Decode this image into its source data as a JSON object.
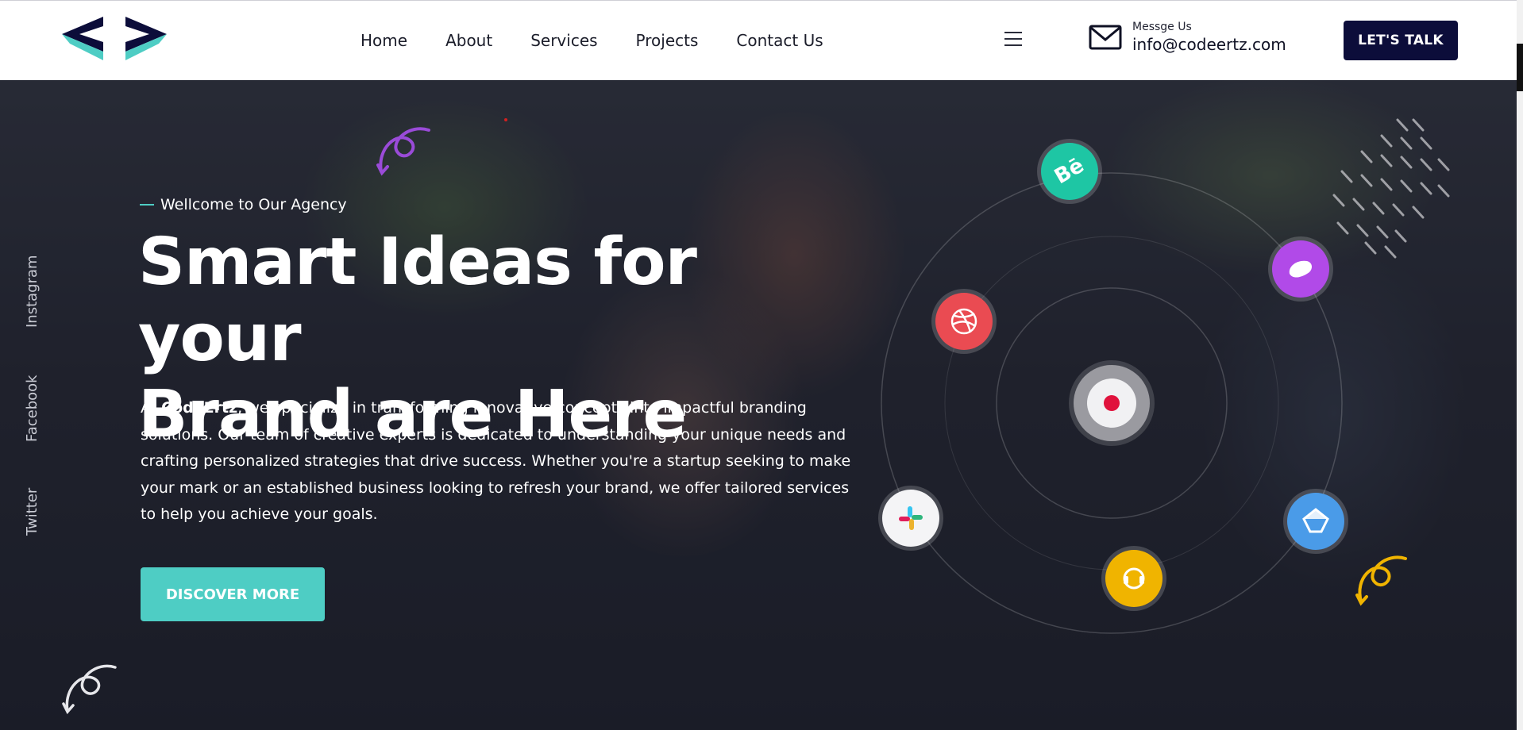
{
  "header": {
    "nav": [
      "Home",
      "About",
      "Services",
      "Projects",
      "Contact Us"
    ],
    "contact_label": "Messge Us",
    "contact_email": "info@codeertz.com",
    "cta_label": "LET'S TALK"
  },
  "social": [
    "Instagram",
    "Facebook",
    "Twitter"
  ],
  "hero": {
    "eyebrow": "Wellcome to Our Agency",
    "title_line1": "Smart Ideas for your",
    "title_line2": "Brand are Here",
    "description_prefix": "At ",
    "description_brand": "CodeErtz",
    "description_rest": ", we specialize in transforming innovative concepts into impactful branding solutions. Our team of creative experts is dedicated to understanding your unique needs and crafting personalized strategies that drive success. Whether you're a startup seeking to make your mark or an established business looking to refresh your brand, we offer tailored services to help you achieve your goals.",
    "button_label": "DISCOVER MORE"
  },
  "orbit_icons": [
    {
      "name": "behance-icon",
      "color": "#1ec6a4",
      "glyph": "Bē"
    },
    {
      "name": "blob-app-icon",
      "color": "#b14ae8",
      "glyph": ""
    },
    {
      "name": "dribbble-icon",
      "color": "#ea4b52",
      "glyph": ""
    },
    {
      "name": "center-app-icon",
      "color": "#d8d8dc",
      "glyph": ""
    },
    {
      "name": "slack-icon",
      "color": "#f4f4f6",
      "glyph": ""
    },
    {
      "name": "support-icon",
      "color": "#f0b400",
      "glyph": ""
    },
    {
      "name": "sketch-icon",
      "color": "#4a9be8",
      "glyph": ""
    }
  ],
  "colors": {
    "accent": "#4ecdc4",
    "navy": "#0c0d3a"
  }
}
